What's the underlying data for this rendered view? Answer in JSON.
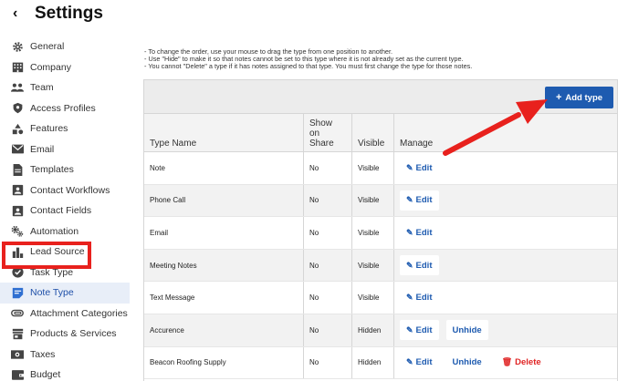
{
  "header": {
    "back_icon": "‹",
    "title": "Settings"
  },
  "sidebar": {
    "items": [
      {
        "label": "General",
        "icon": "gear-icon"
      },
      {
        "label": "Company",
        "icon": "building-icon"
      },
      {
        "label": "Team",
        "icon": "team-icon"
      },
      {
        "label": "Access Profiles",
        "icon": "shield-user-icon"
      },
      {
        "label": "Features",
        "icon": "shapes-icon"
      },
      {
        "label": "Email",
        "icon": "envelope-icon"
      },
      {
        "label": "Templates",
        "icon": "document-icon"
      },
      {
        "label": "Contact Workflows",
        "icon": "contact-card-icon"
      },
      {
        "label": "Contact Fields",
        "icon": "contact-card-icon"
      },
      {
        "label": "Automation",
        "icon": "cogs-icon"
      },
      {
        "label": "Lead Source",
        "icon": "bar-chart-icon"
      },
      {
        "label": "Task Type",
        "icon": "check-circle-icon"
      },
      {
        "label": "Note Type",
        "icon": "note-icon",
        "active": true
      },
      {
        "label": "Attachment Categories",
        "icon": "paperclip-icon"
      },
      {
        "label": "Products & Services",
        "icon": "store-icon"
      },
      {
        "label": "Taxes",
        "icon": "money-icon"
      },
      {
        "label": "Budget",
        "icon": "wallet-icon"
      }
    ]
  },
  "notes": {
    "line1": "- To change the order, use your mouse to drag the type from one position to another.",
    "line2": "- Use \"Hide\" to make it so that notes cannot be set to this type where it is not already set as the current type.",
    "line3": "- You cannot \"Delete\" a type if it has notes assigned to that type. You must first change the type for those notes."
  },
  "toolbar": {
    "add_label": "Add type",
    "add_icon": "+"
  },
  "table": {
    "headers": {
      "type_name": "Type Name",
      "show_on_share_1": "Show",
      "show_on_share_2": "on",
      "show_on_share_3": "Share",
      "visible": "Visible",
      "manage": "Manage"
    },
    "edit_label": "Edit",
    "unhide_label": "Unhide",
    "delete_label": "Delete",
    "rows": [
      {
        "name": "Note",
        "share": "No",
        "visible": "Visible"
      },
      {
        "name": "Phone Call",
        "share": "No",
        "visible": "Visible"
      },
      {
        "name": "Email",
        "share": "No",
        "visible": "Visible"
      },
      {
        "name": "Meeting Notes",
        "share": "No",
        "visible": "Visible"
      },
      {
        "name": "Text Message",
        "share": "No",
        "visible": "Visible"
      },
      {
        "name": "Accurence",
        "share": "No",
        "visible": "Hidden"
      },
      {
        "name": "Beacon Roofing Supply",
        "share": "No",
        "visible": "Hidden"
      }
    ]
  },
  "colors": {
    "accent": "#1e5bb0",
    "danger": "#e02424",
    "annotation": "#e8211d",
    "toolbar_bg": "#ececec"
  }
}
